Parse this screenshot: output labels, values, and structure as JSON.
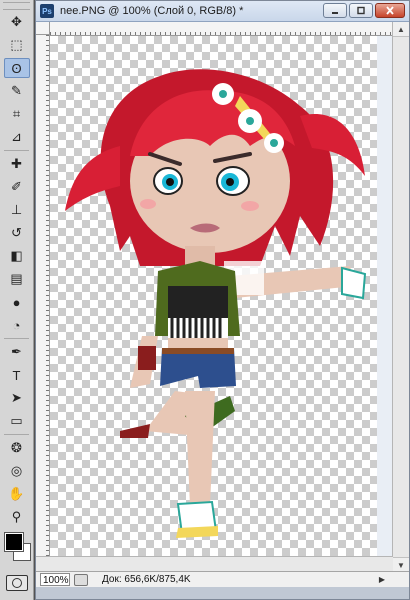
{
  "document": {
    "app_badge": "Ps",
    "title": "nee.PNG @ 100% (Слой 0, RGB/8) *",
    "zoom": "100%",
    "doc_info": "Док: 656,6K/875,4K"
  },
  "tools": [
    {
      "name": "move-tool-icon",
      "glyph": "✥"
    },
    {
      "name": "marquee-tool-icon",
      "glyph": "⬚"
    },
    {
      "name": "lasso-tool-icon",
      "glyph": "ʘ",
      "active": true
    },
    {
      "name": "quick-selection-tool-icon",
      "glyph": "✎"
    },
    {
      "name": "crop-tool-icon",
      "glyph": "⌗"
    },
    {
      "name": "eyedropper-tool-icon",
      "glyph": "⊿"
    },
    {
      "name": "healing-brush-tool-icon",
      "glyph": "✚"
    },
    {
      "name": "brush-tool-icon",
      "glyph": "✐"
    },
    {
      "name": "clone-stamp-tool-icon",
      "glyph": "⊥"
    },
    {
      "name": "history-brush-tool-icon",
      "glyph": "↺"
    },
    {
      "name": "eraser-tool-icon",
      "glyph": "◧"
    },
    {
      "name": "gradient-tool-icon",
      "glyph": "▤"
    },
    {
      "name": "blur-tool-icon",
      "glyph": "●"
    },
    {
      "name": "dodge-tool-icon",
      "glyph": "◔"
    },
    {
      "name": "pen-tool-icon",
      "glyph": "✒"
    },
    {
      "name": "type-tool-icon",
      "glyph": "T"
    },
    {
      "name": "path-selection-tool-icon",
      "glyph": "➤"
    },
    {
      "name": "shape-tool-icon",
      "glyph": "▭"
    },
    {
      "name": "3d-rotate-tool-icon",
      "glyph": "❂"
    },
    {
      "name": "3d-orbit-tool-icon",
      "glyph": "◎"
    },
    {
      "name": "hand-tool-icon",
      "glyph": "✋"
    },
    {
      "name": "zoom-tool-icon",
      "glyph": "⚲"
    }
  ],
  "colors": {
    "foreground": "#000000",
    "background": "#ffffff",
    "hair": "#d81f35",
    "skin": "#e8c7b5",
    "jacket": "#4f6b1e"
  }
}
